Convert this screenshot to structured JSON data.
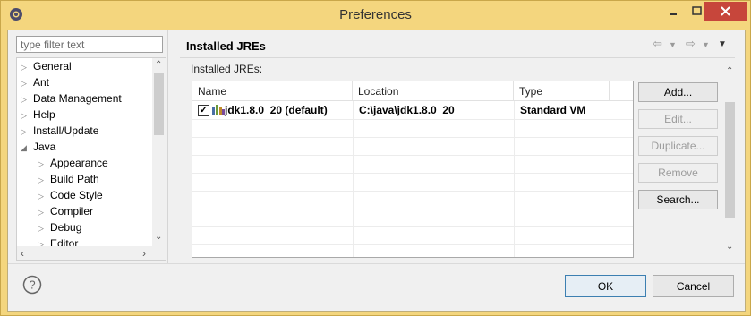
{
  "window": {
    "title": "Preferences"
  },
  "sidebar": {
    "filter_placeholder": "type filter text",
    "items": [
      {
        "label": "General",
        "level": 0,
        "expanded": false
      },
      {
        "label": "Ant",
        "level": 0,
        "expanded": false
      },
      {
        "label": "Data Management",
        "level": 0,
        "expanded": false
      },
      {
        "label": "Help",
        "level": 0,
        "expanded": false
      },
      {
        "label": "Install/Update",
        "level": 0,
        "expanded": false
      },
      {
        "label": "Java",
        "level": 0,
        "expanded": true
      },
      {
        "label": "Appearance",
        "level": 1,
        "expanded": false
      },
      {
        "label": "Build Path",
        "level": 1,
        "expanded": false
      },
      {
        "label": "Code Style",
        "level": 1,
        "expanded": false
      },
      {
        "label": "Compiler",
        "level": 1,
        "expanded": false
      },
      {
        "label": "Debug",
        "level": 1,
        "expanded": false
      },
      {
        "label": "Editor",
        "level": 1,
        "expanded": false
      }
    ]
  },
  "main": {
    "title": "Installed JREs",
    "group_label": "Installed JREs:",
    "table": {
      "columns": [
        "Name",
        "Location",
        "Type"
      ],
      "rows": [
        {
          "checked": true,
          "name": "jdk1.8.0_20 (default)",
          "location": "C:\\java\\jdk1.8.0_20",
          "type": "Standard VM"
        }
      ]
    },
    "buttons": {
      "add": "Add...",
      "edit": "Edit...",
      "duplicate": "Duplicate...",
      "remove": "Remove",
      "search": "Search..."
    }
  },
  "footer": {
    "ok": "OK",
    "cancel": "Cancel"
  },
  "colors": {
    "titlebar": "#f4d67e",
    "close_button": "#c7463b",
    "ok_border": "#3c7fb1"
  }
}
